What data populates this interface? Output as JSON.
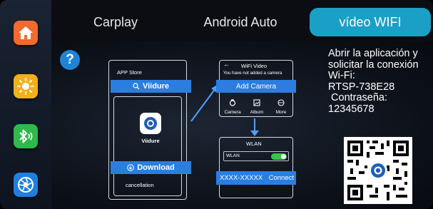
{
  "tabs": [
    {
      "label": "Carplay"
    },
    {
      "label": "Android Auto"
    },
    {
      "label": "vídeo WIFI",
      "active": true
    }
  ],
  "sidebar": {
    "items": [
      {
        "icon": "home-icon",
        "color": "#f26a2c"
      },
      {
        "icon": "brightness-icon",
        "color": "#f2b01b"
      },
      {
        "icon": "bluetooth-audio-icon",
        "color": "#2fb94a"
      },
      {
        "icon": "aperture-icon",
        "color": "#1f7fe0"
      }
    ]
  },
  "help": {
    "label": "?"
  },
  "store_phone": {
    "header": "APP Store",
    "search_label": "Viidure",
    "app_name": "Viidure",
    "download_label": "Download",
    "cancel_label": "cancellation"
  },
  "wifi_phone": {
    "back": "←",
    "title": "WiFi Video",
    "subtitle": "You have not added a camera",
    "add_label": "Add Camera",
    "icons": [
      {
        "label": "Camera"
      },
      {
        "label": "Album"
      },
      {
        "label": "More"
      }
    ]
  },
  "wlan_phone": {
    "title": "WLAN",
    "toggle_label": "WLAN",
    "network": "XXXX-XXXXX",
    "connect_label": "Connect"
  },
  "instructions": {
    "lines": [
      "Abrir la aplicación y",
      "solicitar la conexión",
      "Wi-Fi:",
      "RTSP-738E28",
      " Contraseña:",
      "12345678"
    ]
  },
  "colors": {
    "accent": "#1aa0c7",
    "highlight": "#2b7ee0"
  }
}
